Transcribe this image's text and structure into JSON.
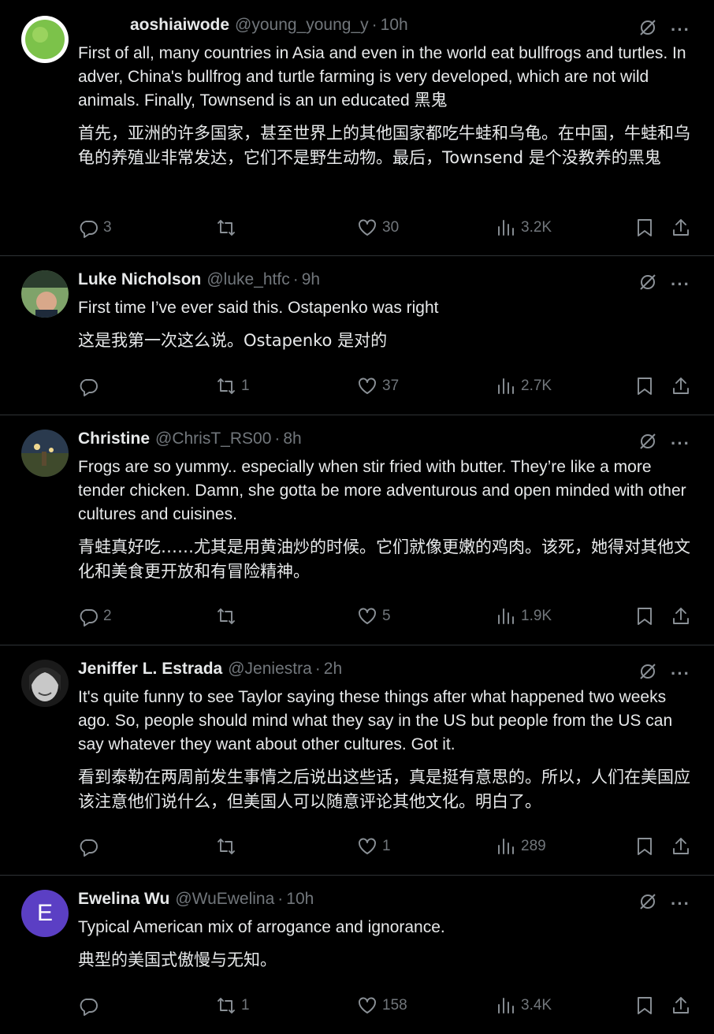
{
  "tweets": [
    {
      "name": "aoshiaiwode",
      "handle": "@young_young_y",
      "separator": "·",
      "time": "10h",
      "text": "First of all, many countries in Asia and even in the world eat bullfrogs and turtles. In adver, China's bullfrog and turtle farming is very developed, which are not wild animals. Finally, Townsend is an un educated 黑鬼",
      "translation": "首先，亚洲的许多国家，甚至世界上的其他国家都吃牛蛙和乌龟。在中国，牛蛙和乌龟的养殖业非常发达，它们不是野生动物。最后，Townsend 是个没教养的黑鬼",
      "replies": "3",
      "reposts": "",
      "likes": "30",
      "views": "3.2K",
      "avatar_color": "#7cc24a"
    },
    {
      "name": "Luke Nicholson",
      "handle": "@luke_htfc",
      "separator": "·",
      "time": "9h",
      "text": "First time I’ve ever said this. Ostapenko was right",
      "translation": "这是我第一次这么说。Ostapenko 是对的",
      "replies": "",
      "reposts": "1",
      "likes": "37",
      "views": "2.7K",
      "avatar_color": "#3a5a3a"
    },
    {
      "name": "Christine",
      "handle": "@ChrisT_RS00",
      "separator": "·",
      "time": "8h",
      "text": "Frogs are so yummy.. especially when stir fried with butter. They’re like a more tender chicken. Damn, she gotta be more adventurous and open minded with other cultures and cuisines.",
      "translation": "青蛙真好吃……尤其是用黄油炒的时候。它们就像更嫩的鸡肉。该死，她得对其他文化和美食更开放和有冒险精神。",
      "replies": "2",
      "reposts": "",
      "likes": "5",
      "views": "1.9K",
      "avatar_color": "#4a5a6a"
    },
    {
      "name": "Jeniffer L. Estrada",
      "handle": "@Jeniestra",
      "separator": "·",
      "time": "2h",
      "text": "It's quite funny to see Taylor saying these things after what happened two weeks ago. So, people should mind what they say in the US but people from the US can say whatever they want about other cultures. Got it.",
      "translation": "看到泰勒在两周前发生事情之后说出这些话，真是挺有意思的。所以，人们在美国应该注意他们说什么，但美国人可以随意评论其他文化。明白了。",
      "replies": "",
      "reposts": "",
      "likes": "1",
      "views": "289",
      "avatar_color": "#bbbbbb"
    },
    {
      "name": "Ewelina Wu",
      "handle": "@WuEwelina",
      "separator": "·",
      "time": "10h",
      "text": "Typical American mix of arrogance and ignorance.",
      "translation": "典型的美国式傲慢与无知。",
      "replies": "",
      "reposts": "1",
      "likes": "158",
      "views": "3.4K",
      "avatar_letter": "E",
      "avatar_color": "#5b3fc4"
    }
  ],
  "more_label": "···"
}
